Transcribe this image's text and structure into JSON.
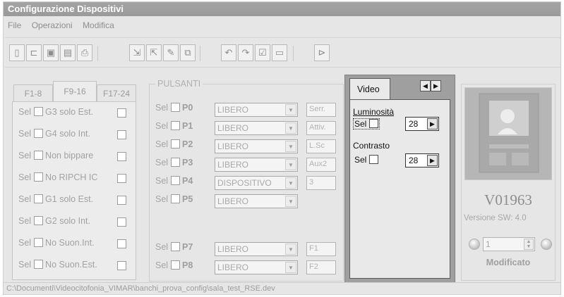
{
  "window": {
    "title": "Configurazione Dispositivi"
  },
  "menu": [
    "File",
    "Operazioni",
    "Modifica"
  ],
  "toolbar": [
    {
      "icon": "new-file-icon",
      "glyph": "▯"
    },
    {
      "icon": "open-folder-icon",
      "glyph": "⊏"
    },
    {
      "icon": "save-icon",
      "glyph": "▣"
    },
    {
      "icon": "copy-stack-icon",
      "glyph": "▤"
    },
    {
      "icon": "print-icon",
      "glyph": "⎙"
    },
    {
      "icon": "import-icon",
      "glyph": "⇲"
    },
    {
      "icon": "export-icon",
      "glyph": "⇱"
    },
    {
      "icon": "edit-icon",
      "glyph": "✎"
    },
    {
      "icon": "clipboard-icon",
      "glyph": "⧉"
    },
    {
      "icon": "undo-icon",
      "glyph": "↶"
    },
    {
      "icon": "redo-icon",
      "glyph": "↷"
    },
    {
      "icon": "check-icon",
      "glyph": "☑"
    },
    {
      "icon": "window-icon",
      "glyph": "▭"
    },
    {
      "icon": "exit-door-icon",
      "glyph": "⊳"
    }
  ],
  "left_tabs": {
    "tabs": [
      "F1-8",
      "F9-16",
      "F17-24"
    ],
    "active": "F9-16",
    "rows": [
      {
        "sel": "Sel",
        "label": "G3 solo Est."
      },
      {
        "sel": "Sel",
        "label": "G4 solo Int."
      },
      {
        "sel": "Sel",
        "label": "Non bippare"
      },
      {
        "sel": "Sel",
        "label": "No RIPCH IC"
      },
      {
        "sel": "Sel",
        "label": "G1 solo Est."
      },
      {
        "sel": "Sel",
        "label": "G2 solo Int."
      },
      {
        "sel": "Sel",
        "label": "No Suon.Int."
      },
      {
        "sel": "Sel",
        "label": "No Suon.Est."
      }
    ]
  },
  "pulsanti": {
    "title": "PULSANTI",
    "rows": [
      {
        "sel": "Sel",
        "key": "P0",
        "value": "LIBERO",
        "box": "Serr."
      },
      {
        "sel": "Sel",
        "key": "P1",
        "value": "LIBERO",
        "box": "Attiv."
      },
      {
        "sel": "Sel",
        "key": "P2",
        "value": "LIBERO",
        "box": "L.Sc"
      },
      {
        "sel": "Sel",
        "key": "P3",
        "value": "LIBERO",
        "box": "Aux2"
      },
      {
        "sel": "Sel",
        "key": "P4",
        "value": "DISPOSITIVO",
        "box": "3"
      },
      {
        "sel": "Sel",
        "key": "P5",
        "value": "LIBERO",
        "box": ""
      },
      {
        "sel": "Sel",
        "key": "P7",
        "value": "LIBERO",
        "box": "F1"
      },
      {
        "sel": "Sel",
        "key": "P8",
        "value": "LIBERO",
        "box": "F2"
      }
    ]
  },
  "video": {
    "tab": "Video",
    "luminosita_label": "Luminosità",
    "luminosita_sel": "Sel",
    "luminosita_value": "28",
    "contrasto_label": "Contrasto",
    "contrasto_sel": "Sel",
    "contrasto_value": "28"
  },
  "device": {
    "code": "V01963",
    "version": "Versione SW: 4.0",
    "counter": "1",
    "status": "Modificato"
  },
  "statusbar": "C:\\Documenti\\Videocitofonia_VIMAR\\banchi_prova_config\\sala_test_RSE.dev"
}
